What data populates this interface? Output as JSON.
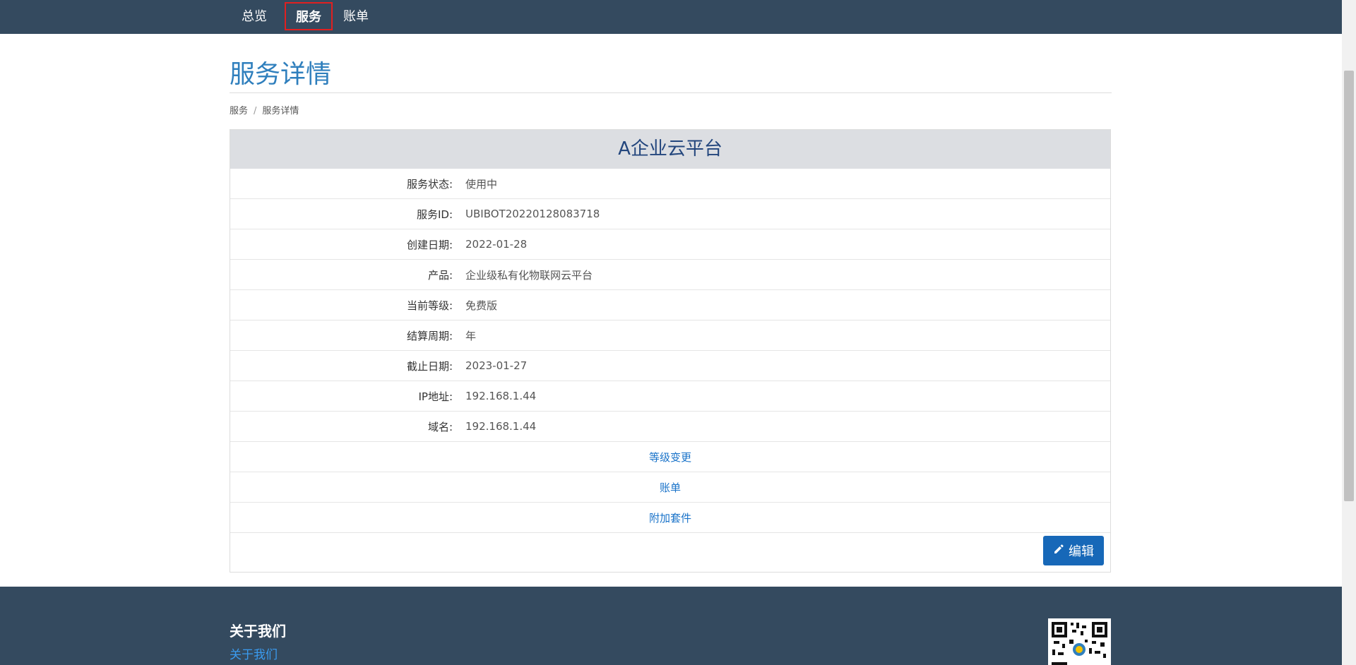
{
  "nav": {
    "items": [
      "总览",
      "服务",
      "账单"
    ]
  },
  "page": {
    "title": "服务详情"
  },
  "breadcrumb": {
    "parent": "服务",
    "separator": "/",
    "current": "服务详情"
  },
  "service": {
    "name": "A企业云平台",
    "fields": [
      {
        "label": "服务状态:",
        "value": "使用中"
      },
      {
        "label": "服务ID:",
        "value": "UBIBOT20220128083718"
      },
      {
        "label": "创建日期:",
        "value": "2022-01-28"
      },
      {
        "label": "产品:",
        "value": "企业级私有化物联网云平台"
      },
      {
        "label": "当前等级:",
        "value": "免费版"
      },
      {
        "label": "结算周期:",
        "value": "年"
      },
      {
        "label": "截止日期:",
        "value": "2023-01-27"
      },
      {
        "label": "IP地址:",
        "value": "192.168.1.44"
      },
      {
        "label": "域名:",
        "value": "192.168.1.44"
      }
    ],
    "links": [
      "等级变更",
      "账单",
      "附加套件"
    ],
    "edit_label": "编辑"
  },
  "footer": {
    "title": "关于我们",
    "link": "关于我们"
  },
  "icons": {
    "edit": "pencil-icon",
    "qr": "qr-code-icon"
  },
  "colors": {
    "nav_bg": "#344a5f",
    "title": "#2f7fbd",
    "link": "#1a73c9",
    "button": "#1768b8",
    "highlight": "#e02020"
  }
}
